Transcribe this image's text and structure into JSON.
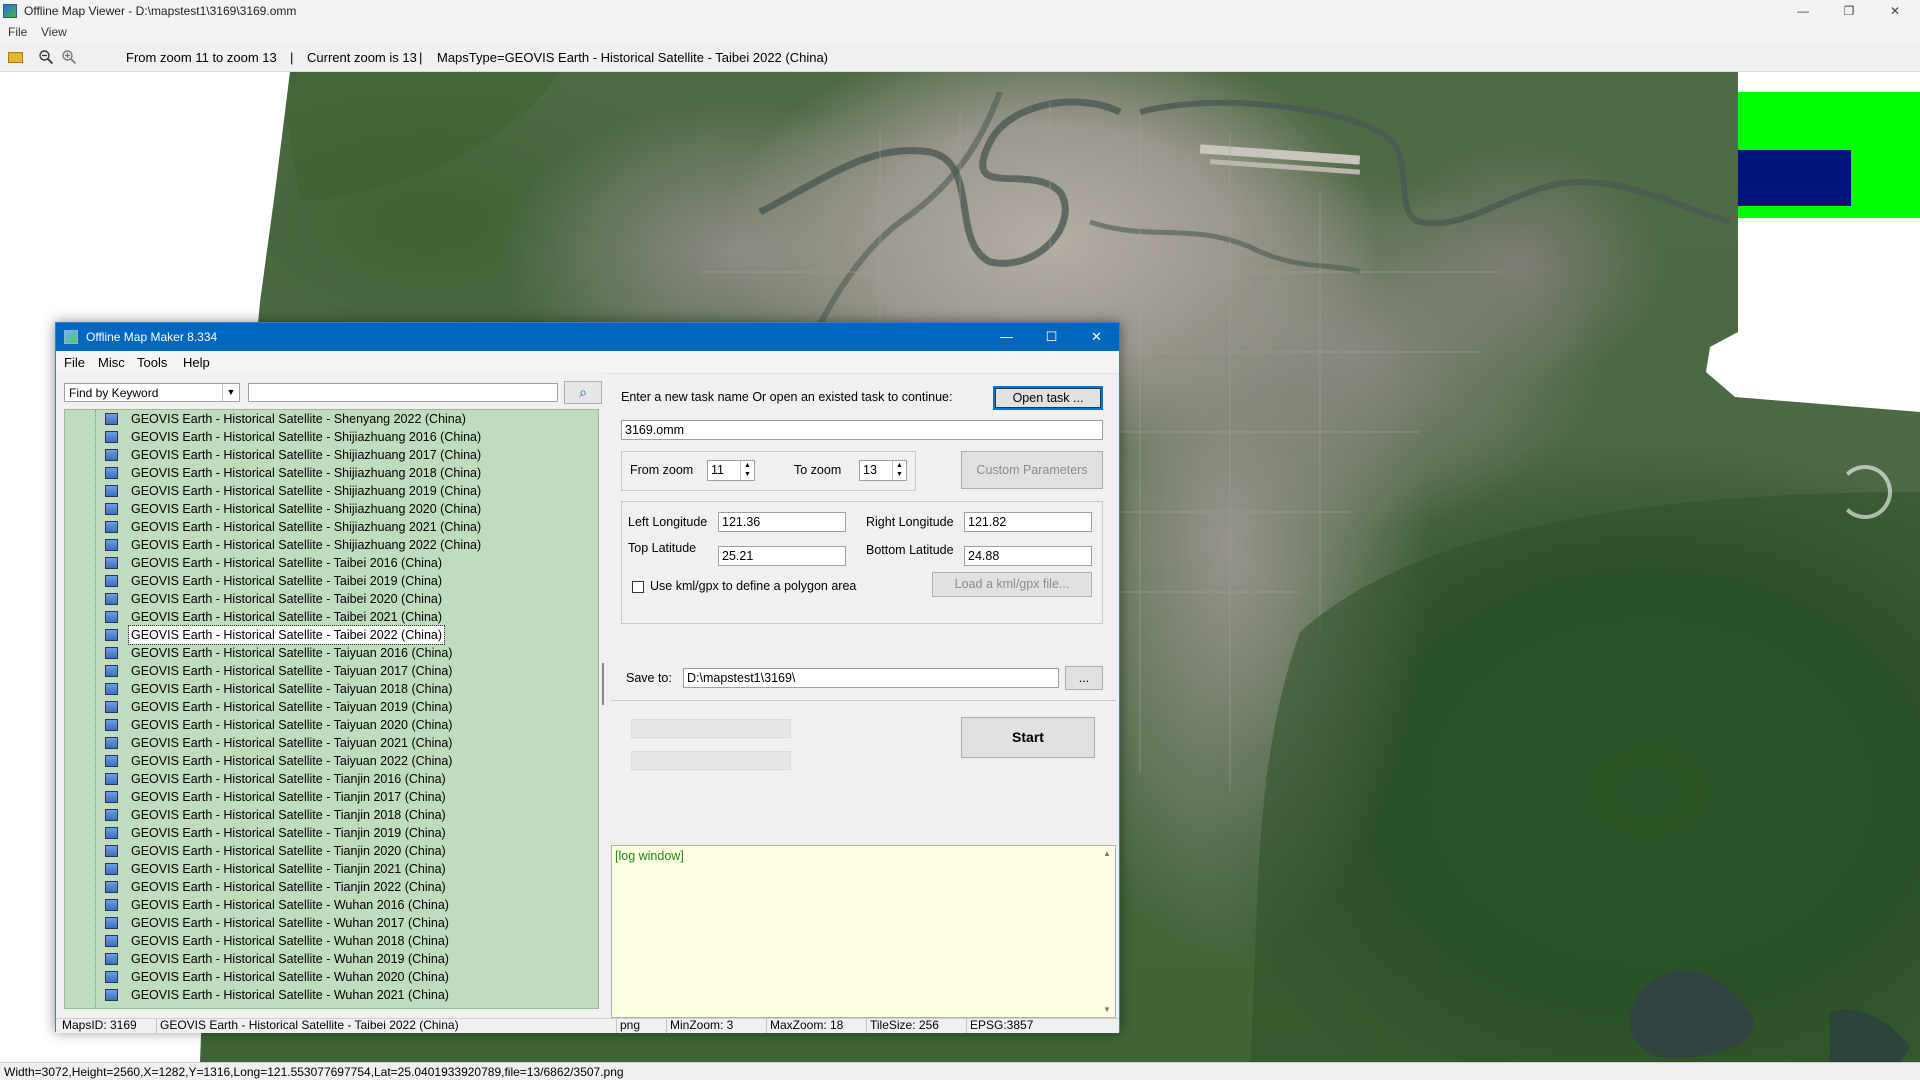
{
  "viewer": {
    "title": "Offline Map Viewer - D:\\mapstest1\\3169\\3169.omm",
    "window_controls": {
      "minimize": "—",
      "maximize": "❐",
      "close": "✕"
    },
    "menu": [
      "File",
      "View"
    ],
    "toolbar": {
      "zoom_range": "From zoom 11 to zoom 13",
      "sep1": "|",
      "current_zoom": "Current zoom is 13",
      "sep2": "|",
      "maps_type": "MapsType=GEOVIS Earth - Historical Satellite - Taibei 2022 (China)"
    },
    "status": "Width=3072,Height=2560,X=1282,Y=1316,Long=121.553077697754,Lat=25.0401933920789,file=13/6862/3507.png",
    "colors": {
      "legend_green": "#00ff00",
      "legend_blue": "#00157a"
    }
  },
  "maker": {
    "title": "Offline Map Maker 8.334",
    "window_controls": {
      "minimize": "—",
      "maximize": "☐",
      "close": "✕"
    },
    "menu": [
      "File",
      "Misc",
      "Tools",
      "Help"
    ],
    "search": {
      "mode": "Find by Keyword",
      "dropdown_arrow": "▼",
      "query": "",
      "button_icon": "⌕"
    },
    "map_list": [
      "GEOVIS Earth - Historical Satellite - Shenyang 2022 (China)",
      "GEOVIS Earth - Historical Satellite - Shijiazhuang 2016 (China)",
      "GEOVIS Earth - Historical Satellite - Shijiazhuang 2017 (China)",
      "GEOVIS Earth - Historical Satellite - Shijiazhuang 2018 (China)",
      "GEOVIS Earth - Historical Satellite - Shijiazhuang 2019 (China)",
      "GEOVIS Earth - Historical Satellite - Shijiazhuang 2020 (China)",
      "GEOVIS Earth - Historical Satellite - Shijiazhuang 2021 (China)",
      "GEOVIS Earth - Historical Satellite - Shijiazhuang 2022 (China)",
      "GEOVIS Earth - Historical Satellite - Taibei 2016 (China)",
      "GEOVIS Earth - Historical Satellite - Taibei 2019 (China)",
      "GEOVIS Earth - Historical Satellite - Taibei 2020 (China)",
      "GEOVIS Earth - Historical Satellite - Taibei 2021 (China)",
      "GEOVIS Earth - Historical Satellite - Taibei 2022 (China)",
      "GEOVIS Earth - Historical Satellite - Taiyuan 2016 (China)",
      "GEOVIS Earth - Historical Satellite - Taiyuan 2017 (China)",
      "GEOVIS Earth - Historical Satellite - Taiyuan 2018 (China)",
      "GEOVIS Earth - Historical Satellite - Taiyuan 2019 (China)",
      "GEOVIS Earth - Historical Satellite - Taiyuan 2020 (China)",
      "GEOVIS Earth - Historical Satellite - Taiyuan 2021 (China)",
      "GEOVIS Earth - Historical Satellite - Taiyuan 2022 (China)",
      "GEOVIS Earth - Historical Satellite - Tianjin 2016 (China)",
      "GEOVIS Earth - Historical Satellite - Tianjin 2017 (China)",
      "GEOVIS Earth - Historical Satellite - Tianjin 2018 (China)",
      "GEOVIS Earth - Historical Satellite - Tianjin 2019 (China)",
      "GEOVIS Earth - Historical Satellite - Tianjin 2020 (China)",
      "GEOVIS Earth - Historical Satellite - Tianjin 2021 (China)",
      "GEOVIS Earth - Historical Satellite - Tianjin 2022 (China)",
      "GEOVIS Earth - Historical Satellite - Wuhan 2016 (China)",
      "GEOVIS Earth - Historical Satellite - Wuhan 2017 (China)",
      "GEOVIS Earth - Historical Satellite - Wuhan 2018 (China)",
      "GEOVIS Earth - Historical Satellite - Wuhan 2019 (China)",
      "GEOVIS Earth - Historical Satellite - Wuhan 2020 (China)",
      "GEOVIS Earth - Historical Satellite - Wuhan 2021 (China)"
    ],
    "selected_map": "GEOVIS Earth - Historical Satellite - Taibei 2022 (China)",
    "task": {
      "prompt": "Enter a new task name Or open an existed task to continue:",
      "open_button": "Open task ...",
      "name": "3169.omm"
    },
    "zoom": {
      "from_label": "From zoom",
      "from_value": "11",
      "to_label": "To zoom",
      "to_value": "13",
      "spin_up": "▲",
      "spin_down": "▼",
      "custom_button": "Custom Parameters"
    },
    "bounds": {
      "left_lon_label": "Left Longitude",
      "left_lon": "121.36",
      "right_lon_label": "Right Longitude",
      "right_lon": "121.82",
      "top_lat_label": "Top Latitude",
      "top_lat": "25.21",
      "bottom_lat_label": "Bottom Latitude",
      "bottom_lat": "24.88",
      "kml_checkbox_label": "Use kml/gpx to define a polygon area",
      "kml_checked": false,
      "load_kml_button": "Load a kml/gpx file..."
    },
    "save": {
      "label": "Save to:",
      "path": "D:\\mapstest1\\3169\\",
      "browse_button": "..."
    },
    "start_button": "Start",
    "log": {
      "text": "[log window]",
      "scroll_up": "▲",
      "scroll_down": "▼"
    },
    "status": {
      "maps_id": "MapsID: 3169",
      "maps_name": "GEOVIS Earth - Historical Satellite - Taibei 2022 (China)",
      "format": "png",
      "min_zoom": "MinZoom: 3",
      "max_zoom": "MaxZoom: 18",
      "tile_size": "TileSize: 256",
      "epsg": "EPSG:3857"
    }
  }
}
